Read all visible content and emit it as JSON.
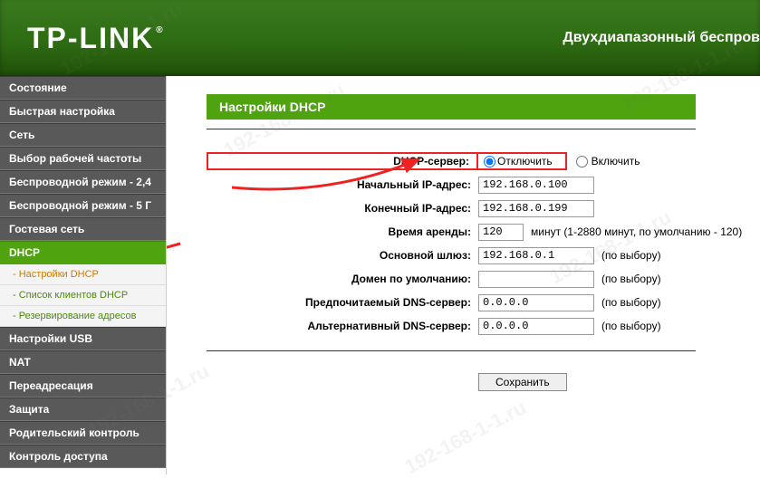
{
  "brand": {
    "logo": "TP-LINK",
    "tagline": "Двухдиапазонный беспров"
  },
  "sidebar": {
    "items": [
      {
        "label": "Состояние",
        "type": "item"
      },
      {
        "label": "Быстрая настройка",
        "type": "item"
      },
      {
        "label": "Сеть",
        "type": "item"
      },
      {
        "label": "Выбор рабочей частоты",
        "type": "item"
      },
      {
        "label": "Беспроводной режим - 2,4",
        "type": "item"
      },
      {
        "label": "Беспроводной режим - 5 Г",
        "type": "item"
      },
      {
        "label": "Гостевая сеть",
        "type": "item"
      },
      {
        "label": "DHCP",
        "type": "active",
        "children": [
          {
            "label": "- Настройки DHCP",
            "current": true
          },
          {
            "label": "- Список клиентов DHCP"
          },
          {
            "label": "- Резервирование адресов"
          }
        ]
      },
      {
        "label": "Настройки USB",
        "type": "item"
      },
      {
        "label": "NAT",
        "type": "item"
      },
      {
        "label": "Переадресация",
        "type": "item"
      },
      {
        "label": "Защита",
        "type": "item"
      },
      {
        "label": "Родительский контроль",
        "type": "item"
      },
      {
        "label": "Контроль доступа",
        "type": "item"
      }
    ]
  },
  "page": {
    "title": "Настройки DHCP"
  },
  "form": {
    "server_label": "DHCP-сервер:",
    "server_options": {
      "off": "Отключить",
      "on": "Включить"
    },
    "server_value": "off",
    "start_ip_label": "Начальный IP-адрес:",
    "start_ip_value": "192.168.0.100",
    "end_ip_label": "Конечный IP-адрес:",
    "end_ip_value": "192.168.0.199",
    "lease_label": "Время аренды:",
    "lease_value": "120",
    "lease_hint": "минут (1-2880 минут, по умолчанию - 120)",
    "gateway_label": "Основной шлюз:",
    "gateway_value": "192.168.0.1",
    "optional_hint": "(по выбору)",
    "domain_label": "Домен по умолчанию:",
    "domain_value": "",
    "dns1_label": "Предпочитаемый DNS-сервер:",
    "dns1_value": "0.0.0.0",
    "dns2_label": "Альтернативный DNS-сервер:",
    "dns2_value": "0.0.0.0",
    "save_label": "Сохранить"
  },
  "watermark": "192-168-1-1.ru"
}
